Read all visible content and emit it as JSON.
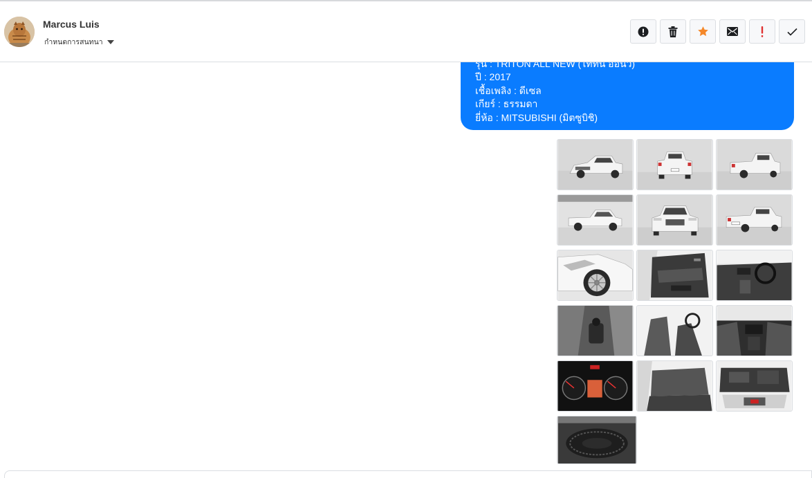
{
  "header": {
    "user_name": "Marcus Luis",
    "status": "กำหนดการสนทนา",
    "actions": [
      {
        "name": "report-icon",
        "color": "#1c1e21"
      },
      {
        "name": "trash-icon",
        "color": "#1c1e21"
      },
      {
        "name": "star-icon",
        "color": "#f5882a"
      },
      {
        "name": "mail-icon",
        "color": "#1c1e21"
      },
      {
        "name": "exclamation-icon",
        "color": "#e02f2f"
      },
      {
        "name": "check-icon",
        "color": "#1c1e21"
      }
    ]
  },
  "message": {
    "lines": [
      "รุ่น : TRITON ALL NEW (ไททัน ออนิว)",
      "ปี : 2017",
      "เชื้อเพลิง : ดีเซล",
      "เกียร์ : ธรรมดา",
      "ยี่ห้อ : MITSUBISHI (มิตซูบิชิ)"
    ],
    "bubble_color": "#0a7cff"
  },
  "photos": [
    {
      "subject": "exterior-front-quarter"
    },
    {
      "subject": "exterior-rear"
    },
    {
      "subject": "exterior-rear-quarter"
    },
    {
      "subject": "exterior-side"
    },
    {
      "subject": "exterior-front"
    },
    {
      "subject": "exterior-rear-quarter-2"
    },
    {
      "subject": "exterior-wheel"
    },
    {
      "subject": "door-panel"
    },
    {
      "subject": "dashboard"
    },
    {
      "subject": "gear-shifter"
    },
    {
      "subject": "front-seats"
    },
    {
      "subject": "center-console"
    },
    {
      "subject": "instrument-cluster"
    },
    {
      "subject": "rear-seats"
    },
    {
      "subject": "engine-bay"
    },
    {
      "subject": "spare-tire"
    }
  ]
}
